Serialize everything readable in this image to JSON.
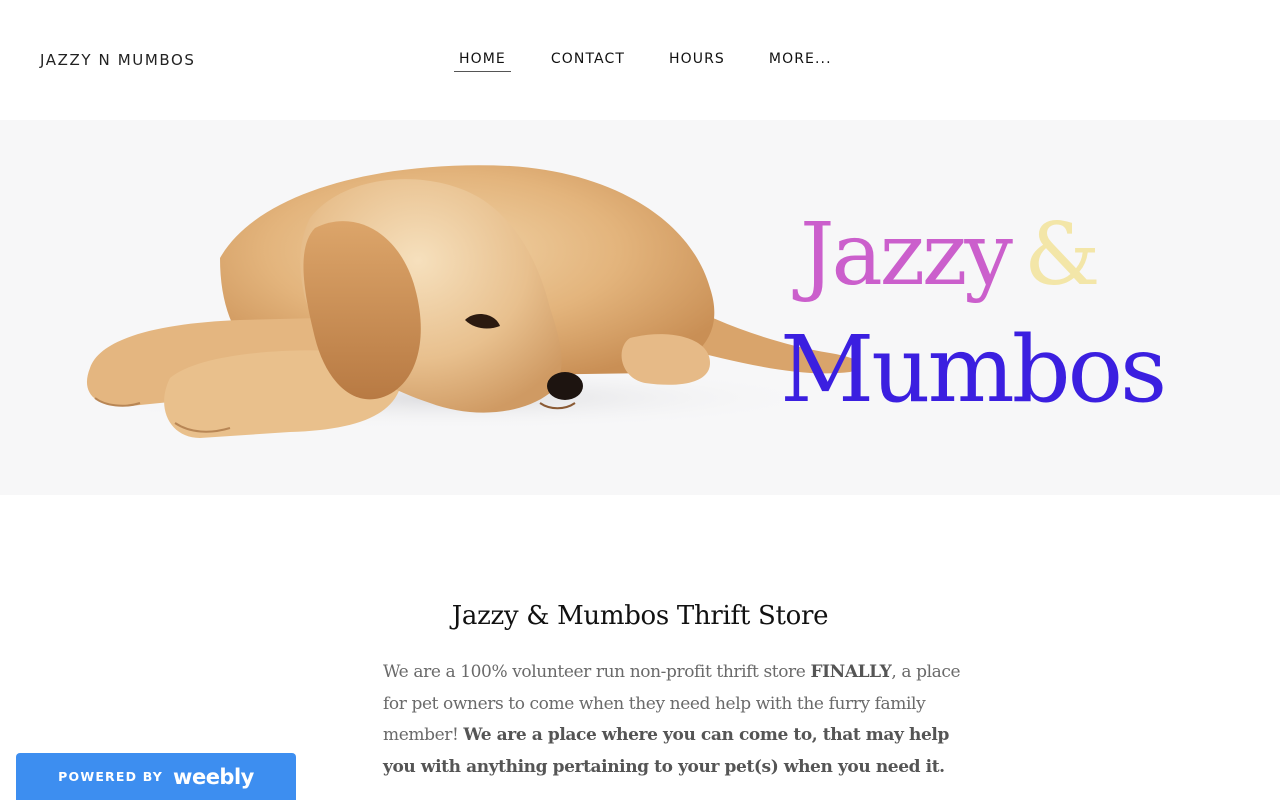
{
  "header": {
    "site_title": "JAZZY N MUMBOS",
    "nav": {
      "home": "HOME",
      "contact": "CONTACT",
      "hours": "HOURS",
      "more": "MORE..."
    },
    "active_item": "home"
  },
  "hero": {
    "image_subject": "golden retriever puppy lying down",
    "brand_word1": "Jazzy",
    "brand_ampersand": "&",
    "brand_word2": "Mumbos",
    "colors": {
      "jazzy": "#cb5fcc",
      "ampersand": "#f3e6a8",
      "mumbos": "#3b1fe0",
      "background": "#f7f7f8"
    }
  },
  "main": {
    "heading": "Jazzy & Mumbos Thrift Store",
    "paragraph": {
      "part1": "We are a 100% volunteer run non-profit thrift store ",
      "part2_bold": "FINALLY",
      "part3": ", a place for pet owners to come when they need help with the furry family member! ",
      "part4_bold": "We are a place where you can come to, that may help you with anything pertaining to your pet(s) when you need it."
    }
  },
  "footer_badge": {
    "powered_by": "POWERED BY",
    "brand": "weebly",
    "color": "#3d8ef0"
  }
}
